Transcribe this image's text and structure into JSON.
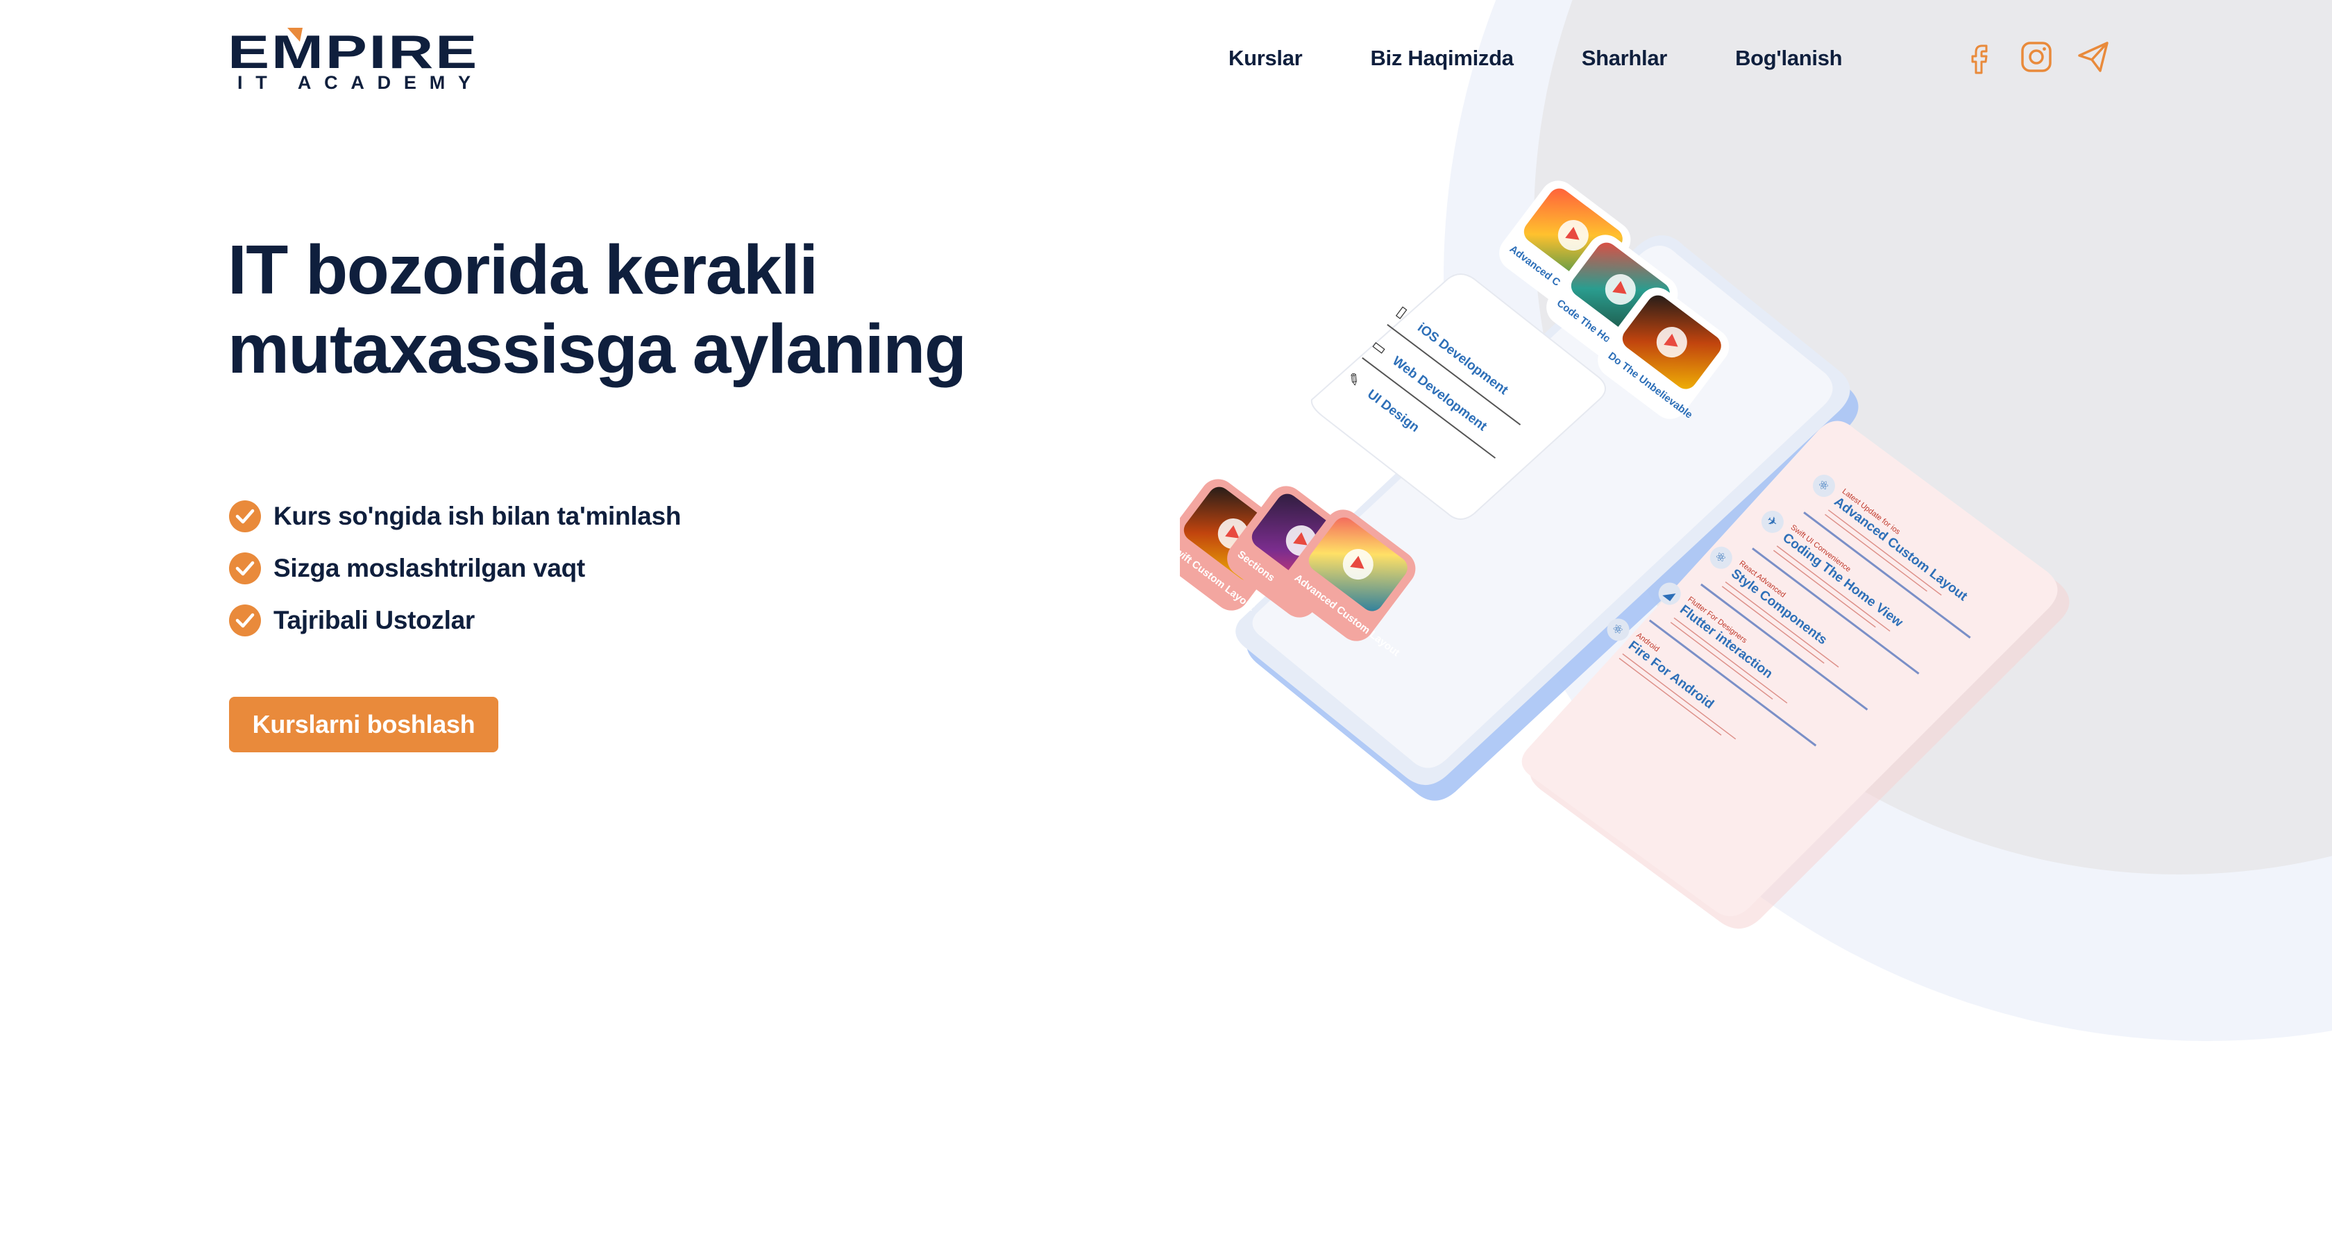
{
  "brand": {
    "name_top": "EMPIRE",
    "name_bottom": "IT ACADEMY",
    "colors": {
      "navy": "#0f1f3d",
      "orange": "#e98a3b"
    }
  },
  "nav": {
    "items": [
      {
        "label": "Kurslar"
      },
      {
        "label": "Biz Haqimizda"
      },
      {
        "label": "Sharhlar"
      },
      {
        "label": "Bog'lanish"
      }
    ]
  },
  "socials": [
    {
      "icon": "facebook-icon"
    },
    {
      "icon": "instagram-icon"
    },
    {
      "icon": "telegram-icon"
    }
  ],
  "hero": {
    "title_line1": "IT bozorida kerakli",
    "title_line2": "mutaxassisga aylaning",
    "features": [
      {
        "text": "Kurs so'ngida ish bilan ta'minlash",
        "icon": "check-circle-icon"
      },
      {
        "text": "Sizga moslashtrilgan vaqt",
        "icon": "check-circle-icon"
      },
      {
        "text": "Tajribali Ustozlar",
        "icon": "check-circle-icon"
      }
    ],
    "cta_label": "Kurslarni boshlash"
  },
  "illustration": {
    "menu": [
      {
        "label": "iOS Development",
        "icon": "phone-icon"
      },
      {
        "label": "Web Development",
        "icon": "monitor-icon"
      },
      {
        "label": "UI Design",
        "icon": "pencil-icon"
      }
    ],
    "top_tiles": [
      {
        "label": "Advanced Custom Layout"
      },
      {
        "label": "Code The Home View"
      },
      {
        "label": "Do The Unbelievable"
      }
    ],
    "bottom_tiles": [
      {
        "label": "Swift Custom Layout"
      },
      {
        "label": "Sections"
      },
      {
        "label": "Advanced Custom Layout"
      }
    ],
    "list_rows": [
      {
        "sub": "Latest Update for ios",
        "title": "Advanced Custom Layout"
      },
      {
        "sub": "Swift UI Convenience",
        "title": "Coding The Home View"
      },
      {
        "sub": "React Advanced",
        "title": "Style Components"
      },
      {
        "sub": "Flutter For Designers",
        "title": "Flutter interaction"
      },
      {
        "sub": "Android",
        "title": "Fire For Android"
      }
    ]
  }
}
